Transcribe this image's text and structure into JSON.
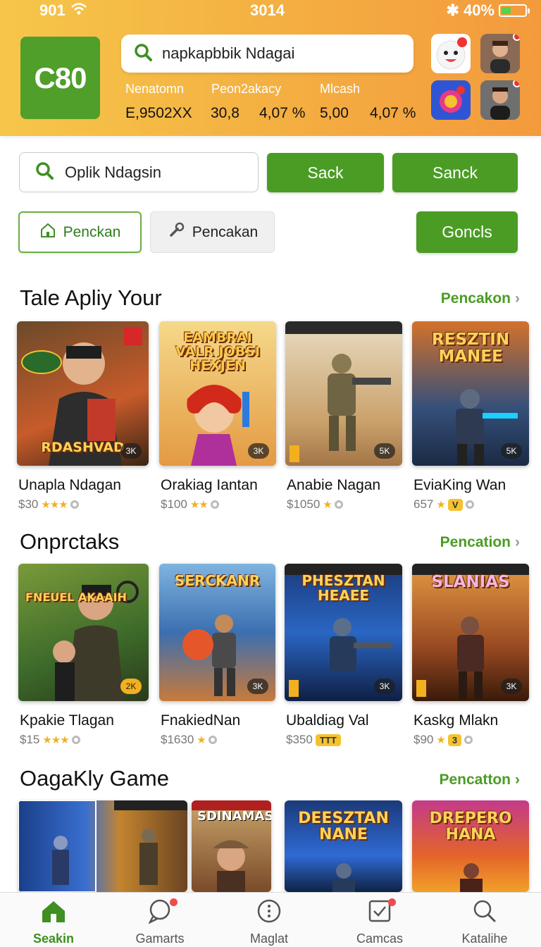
{
  "status_bar": {
    "signal": "901",
    "time": "3014",
    "battery": "40%",
    "battery_level": 0.4
  },
  "header": {
    "logo_text": "C80",
    "search_text": "napkapbbik Ndagai",
    "metric_labels": [
      "Nenatomn",
      "Peon2akacy",
      "Mlcash"
    ],
    "metric_values": [
      "E,9502XX",
      "30,8",
      "4,07 %",
      "5,00",
      "4,07 %"
    ]
  },
  "search": {
    "value": "Oplik Ndagsin",
    "button1": "Sack",
    "button2": "Sanck"
  },
  "filters": {
    "chip1": "Penckan",
    "chip2": "Pencakan",
    "button": "Goncls"
  },
  "sections": [
    {
      "title": "Tale Apliy Your",
      "link": "Pencakon",
      "cards": [
        {
          "cover_title": "RDASHVAD",
          "name": "Unapla Ndagan",
          "price": "$30",
          "stars": "★★★",
          "tag": ""
        },
        {
          "cover_title": "EAMBRAI VALR JOBSI HEXJEN",
          "name": "Orakiag Iantan",
          "price": "$100",
          "stars": "★★",
          "tag": ""
        },
        {
          "cover_title": "",
          "name": "Anabie Nagan",
          "price": "$1050",
          "stars": "★",
          "tag": ""
        },
        {
          "cover_title": "RESZTIN MANEE",
          "name": "EviaKing Wan",
          "price": "657",
          "stars": "★",
          "tag": "V"
        }
      ]
    },
    {
      "title": "Onprctaks",
      "link": "Pencation",
      "cards": [
        {
          "cover_title": "FNEUEL AKAAIH",
          "name": "Kpakie Tlagan",
          "price": "$15",
          "stars": "★★★",
          "tag": ""
        },
        {
          "cover_title": "SERCKANR",
          "name": "FnakiedNan",
          "price": "$1630",
          "stars": "★",
          "tag": ""
        },
        {
          "cover_title": "PHESZTAN HEAEE",
          "name": "Ubaldiag Val",
          "price": "$350",
          "stars": "",
          "tag": "TTT"
        },
        {
          "cover_title": "SLANIAS",
          "name": "Kaskg Mlakn",
          "price": "$90",
          "stars": "★",
          "tag": "3"
        }
      ]
    },
    {
      "title": "OagaKly Game",
      "link": "Pencatton",
      "cards": [
        {
          "cover_title": "",
          "name": "",
          "price": "",
          "stars": "",
          "tag": ""
        },
        {
          "cover_title": "SDINAMAS",
          "name": "",
          "price": "",
          "stars": "",
          "tag": ""
        },
        {
          "cover_title": "DEESZTAN NANE",
          "name": "",
          "price": "",
          "stars": "",
          "tag": ""
        },
        {
          "cover_title": "DREPERO HANA",
          "name": "",
          "price": "",
          "stars": "",
          "tag": ""
        }
      ]
    }
  ],
  "bottom_nav": [
    {
      "label": "Seakin",
      "icon": "home-icon"
    },
    {
      "label": "Gamarts",
      "icon": "chat-icon"
    },
    {
      "label": "Maglat",
      "icon": "more-icon"
    },
    {
      "label": "Camcas",
      "icon": "checklist-icon"
    },
    {
      "label": "Katalihe",
      "icon": "search-icon"
    }
  ],
  "colors": {
    "brand_green": "#4b9c25",
    "header_start": "#f6c64a",
    "header_end": "#f39a3d",
    "star": "#f2b01f"
  }
}
